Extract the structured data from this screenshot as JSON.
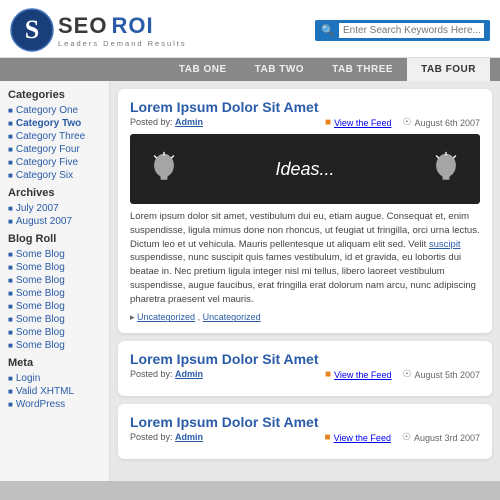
{
  "header": {
    "logo_seo": "SEO",
    "logo_roi": "ROI",
    "tagline": "Leaders  Demand  Results",
    "search_placeholder": "Enter Search Keywords Here..."
  },
  "nav": {
    "tabs": [
      {
        "label": "TAB ONE",
        "active": false
      },
      {
        "label": "TAB TWO",
        "active": false
      },
      {
        "label": "TAB THREE",
        "active": false
      },
      {
        "label": "TAB FOUR",
        "active": true
      }
    ]
  },
  "sidebar": {
    "categories_title": "Categories",
    "categories": [
      {
        "label": "Category One",
        "bold": false
      },
      {
        "label": "Category Two",
        "bold": true
      },
      {
        "label": "Category Three",
        "bold": false
      },
      {
        "label": "Category Four",
        "bold": false
      },
      {
        "label": "Category Five",
        "bold": false
      },
      {
        "label": "Category Six",
        "bold": false
      }
    ],
    "archives_title": "Archives",
    "archives": [
      {
        "label": "July 2007"
      },
      {
        "label": "August 2007"
      }
    ],
    "blogroll_title": "Blog Roll",
    "blogroll": [
      {
        "label": "Some Blog"
      },
      {
        "label": "Some Blog"
      },
      {
        "label": "Some Blog"
      },
      {
        "label": "Some Blog"
      },
      {
        "label": "Some Blog"
      },
      {
        "label": "Some Blog"
      },
      {
        "label": "Some Blog"
      },
      {
        "label": "Some Blog"
      }
    ],
    "meta_title": "Meta",
    "meta": [
      {
        "label": "Login"
      },
      {
        "label": "Valid XHTML"
      },
      {
        "label": "WordPress"
      }
    ]
  },
  "articles": [
    {
      "title": "Lorem Ipsum Dolor Sit Amet",
      "posted_by": "Admin",
      "feed_label": "View the Feed",
      "date": "August 6th 2007",
      "image_text": "Ideas...",
      "body": "Lorem ipsum dolor sit amet, vestibulum dui eu, etiam augue. Consequat et, enim suspendisse, ligula mimus done non rhoncus, ut feugiat ut fringilla, orci urna lectus. Dictum leo et ut vehicula. Mauris pellentesque ut aliquam elit sed. Velit suscipit suspendisse, nunc suscipit quis fames vestibulum, id et gravida, eu lobortis dui beatae in. Nec pretium ligula integer nisl mi tellus, libero laoreet vestibulum suspendisse, augue faucibus, erat fringilla erat dolorum nam arcu, nunc adipiscing pharetra praesent vel mauris.",
      "has_image": true,
      "tags": [
        "Uncategorized",
        "Uncategorized"
      ]
    },
    {
      "title": "Lorem Ipsum Dolor Sit Amet",
      "posted_by": "Admin",
      "feed_label": "View the Feed",
      "date": "August 5th 2007",
      "has_image": false,
      "body": "",
      "tags": []
    },
    {
      "title": "Lorem Ipsum Dolor Sit Amet",
      "posted_by": "Admin",
      "feed_label": "View the Feed",
      "date": "August 3rd 2007",
      "has_image": false,
      "body": "",
      "tags": []
    }
  ]
}
